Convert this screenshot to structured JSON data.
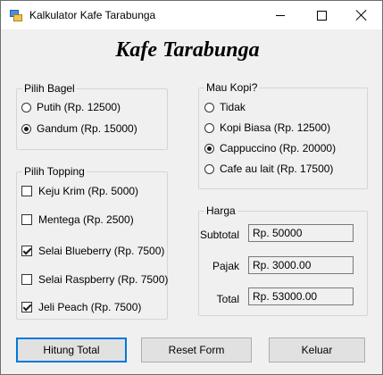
{
  "window": {
    "title": "Kalkulator Kafe Tarabunga"
  },
  "heading": "Kafe Tarabunga",
  "bagel": {
    "label": "Pilih Bagel",
    "options": [
      {
        "label": "Putih (Rp. 12500)",
        "selected": false
      },
      {
        "label": "Gandum (Rp. 15000)",
        "selected": true
      }
    ]
  },
  "topping": {
    "label": "Pilih Topping",
    "options": [
      {
        "label": "Keju Krim (Rp. 5000)",
        "checked": false
      },
      {
        "label": "Mentega (Rp. 2500)",
        "checked": false
      },
      {
        "label": "Selai Blueberry (Rp. 7500)",
        "checked": true
      },
      {
        "label": "Selai Raspberry (Rp. 7500)",
        "checked": false
      },
      {
        "label": "Jeli Peach (Rp. 7500)",
        "checked": true
      }
    ]
  },
  "kopi": {
    "label": "Mau Kopi?",
    "options": [
      {
        "label": "Tidak",
        "selected": false
      },
      {
        "label": "Kopi Biasa (Rp. 12500)",
        "selected": false
      },
      {
        "label": "Cappuccino (Rp. 20000)",
        "selected": true
      },
      {
        "label": "Cafe au lait (Rp. 17500)",
        "selected": false
      }
    ]
  },
  "harga": {
    "label": "Harga",
    "subtotal_label": "Subtotal",
    "subtotal_value": "Rp. 50000",
    "pajak_label": "Pajak",
    "pajak_value": "Rp. 3000.00",
    "total_label": "Total",
    "total_value": "Rp. 53000.00"
  },
  "buttons": {
    "hitung": "Hitung Total",
    "reset": "Reset Form",
    "keluar": "Keluar"
  }
}
